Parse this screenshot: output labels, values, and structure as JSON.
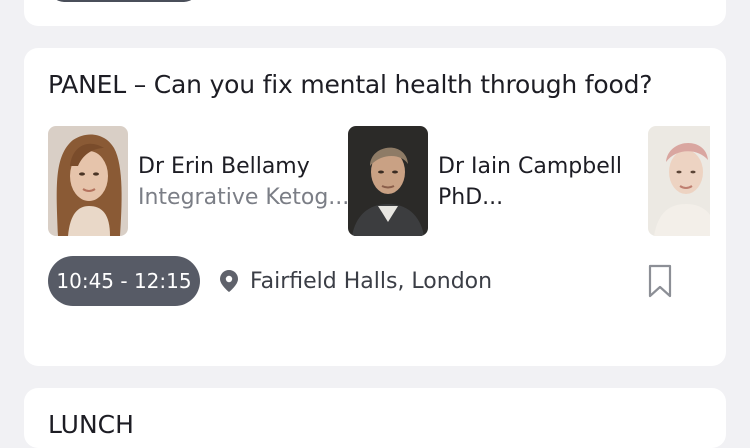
{
  "sessions": {
    "current": {
      "title": "PANEL – Can you fix mental health through food?",
      "speakers": [
        {
          "name": "Dr Erin Bellamy",
          "role": "Integrative Ketog..."
        },
        {
          "name": "Dr Iain Campbell",
          "role": "PhD..."
        },
        {
          "name": "",
          "role": ""
        }
      ],
      "time": "10:45 - 12:15",
      "location": "Fairfield Halls, London"
    },
    "next": {
      "title": "LUNCH"
    }
  },
  "icons": {
    "location": "location-pin-icon",
    "bookmark": "bookmark-icon"
  },
  "colors": {
    "background": "#f1f1f4",
    "card": "#ffffff",
    "time_pill": "#575b66",
    "muted_text": "#7b7e86"
  }
}
